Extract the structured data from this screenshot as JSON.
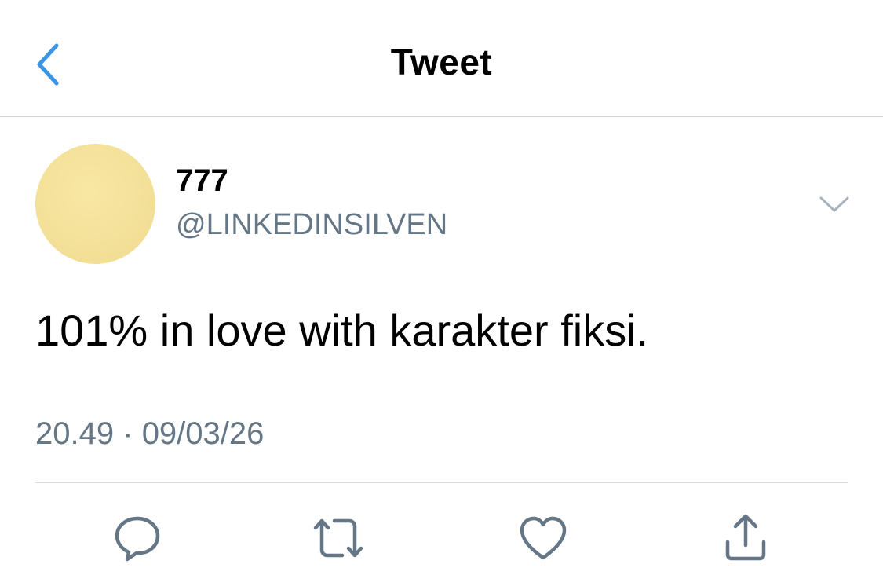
{
  "nav": {
    "title": "Tweet",
    "back_icon": "chevron-left-icon"
  },
  "tweet": {
    "display_name": "777",
    "handle": "@LINKEDINSILVEN",
    "text": "101% in love with karakter fiksi.",
    "time": "20.49",
    "separator": "·",
    "date": "09/03/26",
    "more_icon": "chevron-down-icon"
  },
  "actions": [
    {
      "icon": "reply-icon"
    },
    {
      "icon": "retweet-icon"
    },
    {
      "icon": "like-icon"
    },
    {
      "icon": "share-icon"
    }
  ],
  "colors": {
    "accent": "#1da1f2",
    "secondary_text": "#657786",
    "avatar_fill": "#f4e199"
  }
}
